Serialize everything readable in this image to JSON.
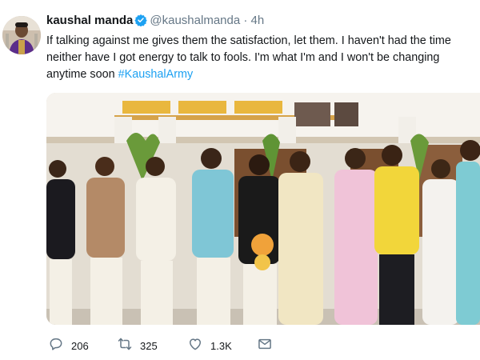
{
  "tweet": {
    "author": {
      "name": "kaushal manda",
      "handle": "@kaushalmanda",
      "verified": true,
      "separator": "·",
      "time": "4h"
    },
    "text": {
      "line1": "If talking against me gives them the satisfaction, let them. I haven't had the time",
      "line2": "neither have I got energy to talk to fools. I'm what I'm and I won't be changing",
      "line3_prefix": "anytime soon ",
      "hashtag": "#KaushalArmy"
    },
    "actions": {
      "reply_count": "206",
      "retweet_count": "325",
      "like_count": "1.3K"
    },
    "colors": {
      "accent": "#1da1f2",
      "text": "#14171a",
      "muted": "#657786"
    },
    "icons": {
      "verified": "verified-badge-icon",
      "reply": "reply-icon",
      "retweet": "retweet-icon",
      "like": "like-icon",
      "direct_message": "direct-message-icon"
    }
  }
}
